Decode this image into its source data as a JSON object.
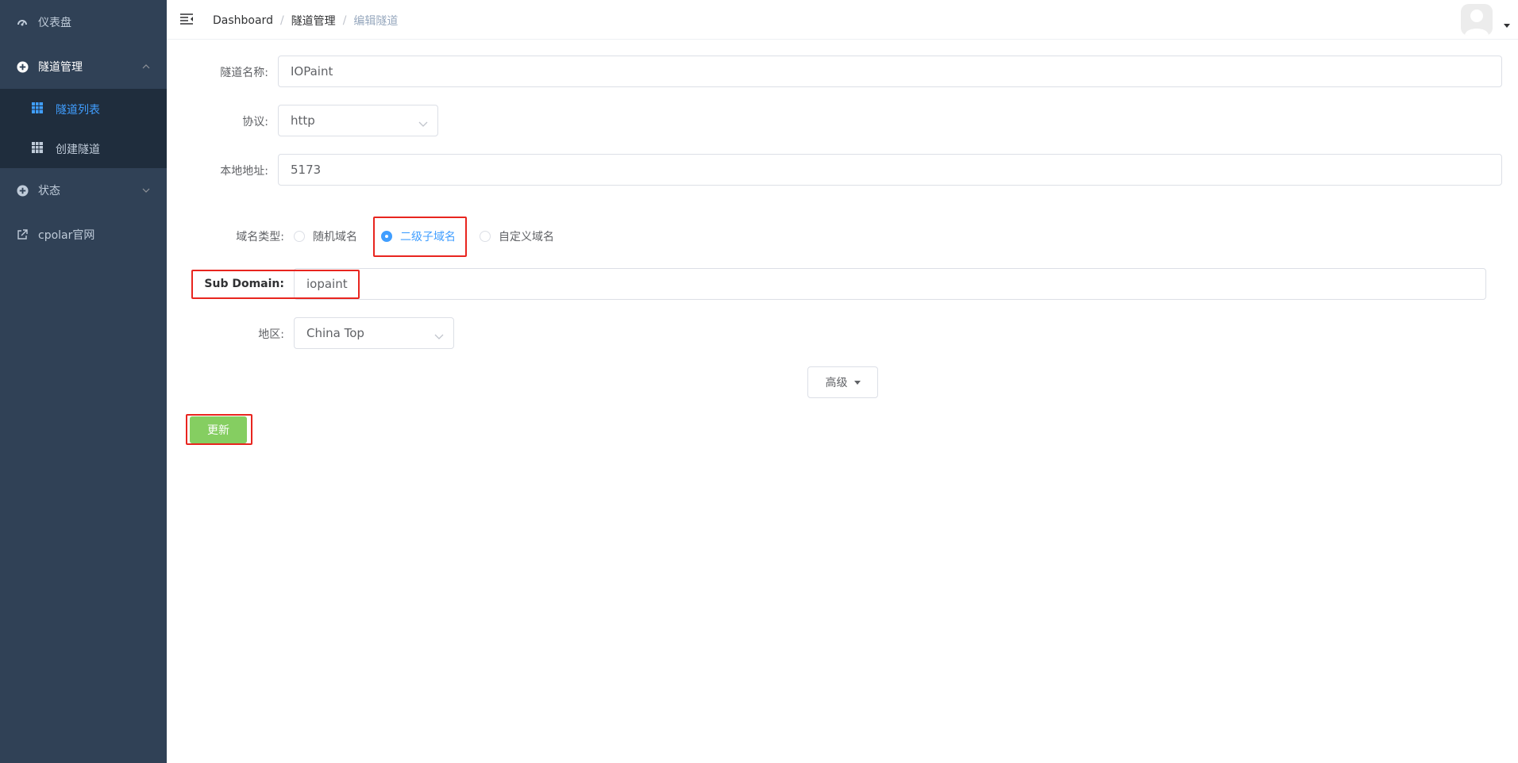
{
  "sidebar": {
    "items": [
      {
        "label": "仪表盘",
        "icon": "dashboard-icon"
      },
      {
        "label": "隧道管理",
        "icon": "plus-circle-icon"
      },
      {
        "label": "状态",
        "icon": "plus-circle-icon"
      },
      {
        "label": "cpolar官网",
        "icon": "external-link-icon"
      }
    ],
    "submenu": [
      {
        "label": "隧道列表",
        "icon": "table-icon",
        "active": true
      },
      {
        "label": "创建隧道",
        "icon": "table-icon",
        "active": false
      }
    ]
  },
  "header": {
    "breadcrumb": [
      "Dashboard",
      "隧道管理",
      "编辑隧道"
    ]
  },
  "form": {
    "tunnel_name": {
      "label": "隧道名称:",
      "value": "IOPaint"
    },
    "protocol": {
      "label": "协议:",
      "value": "http"
    },
    "local_address": {
      "label": "本地地址:",
      "value": "5173"
    },
    "domain_type": {
      "label": "域名类型:",
      "options": [
        "随机域名",
        "二级子域名",
        "自定义域名"
      ],
      "selected": "二级子域名"
    },
    "sub_domain": {
      "label": "Sub Domain:",
      "value": "iopaint"
    },
    "region": {
      "label": "地区:",
      "value": "China Top"
    },
    "advanced_label": "高级",
    "update_label": "更新"
  },
  "colors": {
    "sidebar_bg": "#304156",
    "submenu_bg": "#1f2d3d",
    "accent": "#409eff",
    "update_button": "#85ce61",
    "highlight_box": "#e8251f"
  }
}
